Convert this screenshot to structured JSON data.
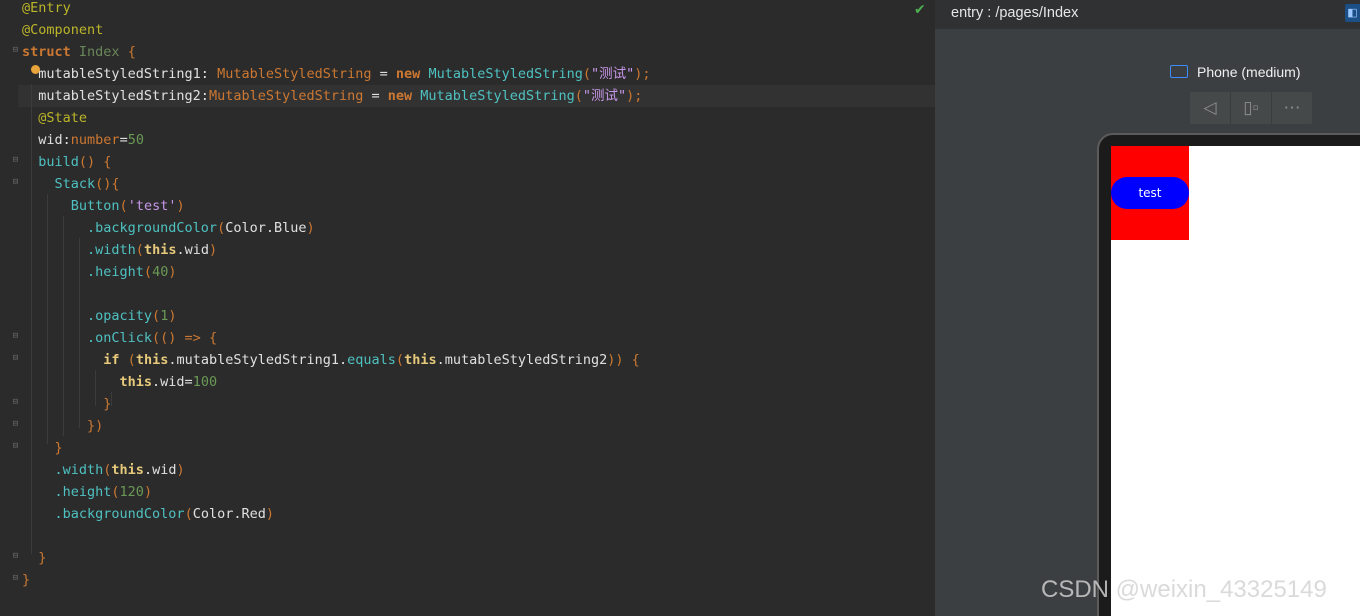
{
  "editor": {
    "lines": [
      [
        {
          "t": "@Entry",
          "c": "#bbb529"
        }
      ],
      [
        {
          "t": "@Component",
          "c": "#bbb529"
        }
      ],
      [
        {
          "t": "struct",
          "c": "#cc7832",
          "b": true
        },
        {
          "t": " "
        },
        {
          "t": "Index",
          "c": "#6a8759"
        },
        {
          "t": " {",
          "c": "#cc7832"
        }
      ],
      [
        {
          "t": "  mutableStyledString1: ",
          "c": "#e0e0e0"
        },
        {
          "t": "MutableStyledString",
          "c": "#cc7832"
        },
        {
          "t": " = ",
          "c": "#e0e0e0"
        },
        {
          "t": "new",
          "c": "#cc7832",
          "b": true
        },
        {
          "t": " "
        },
        {
          "t": "MutableStyledString",
          "c": "#4fc1c1"
        },
        {
          "t": "(",
          "c": "#cc7832"
        },
        {
          "t": "\"测试\"",
          "c": "#c896e8"
        },
        {
          "t": ");",
          "c": "#cc7832"
        }
      ],
      [
        {
          "t": "  mutableStyledString2:",
          "c": "#e0e0e0"
        },
        {
          "t": "MutableStyledString",
          "c": "#cc7832"
        },
        {
          "t": " = ",
          "c": "#e0e0e0"
        },
        {
          "t": "new",
          "c": "#cc7832",
          "b": true
        },
        {
          "t": " "
        },
        {
          "t": "MutableStyledString",
          "c": "#4fc1c1"
        },
        {
          "t": "(",
          "c": "#cc7832"
        },
        {
          "t": "\"测试\"",
          "c": "#c896e8"
        },
        {
          "t": ");",
          "c": "#cc7832"
        }
      ],
      [
        {
          "t": "  @State",
          "c": "#bbb529"
        }
      ],
      [
        {
          "t": "  wid:",
          "c": "#e0e0e0"
        },
        {
          "t": "number",
          "c": "#cc7832"
        },
        {
          "t": "=",
          "c": "#e0e0e0"
        },
        {
          "t": "50",
          "c": "#6a9955"
        }
      ],
      [
        {
          "t": "  build",
          "c": "#4fc1c1"
        },
        {
          "t": "() {",
          "c": "#cc7832"
        }
      ],
      [
        {
          "t": "    Stack",
          "c": "#4fc1c1"
        },
        {
          "t": "(){",
          "c": "#cc7832"
        }
      ],
      [
        {
          "t": "      Button",
          "c": "#4fc1c1"
        },
        {
          "t": "(",
          "c": "#cc7832"
        },
        {
          "t": "'test'",
          "c": "#c896e8"
        },
        {
          "t": ")",
          "c": "#cc7832"
        }
      ],
      [
        {
          "t": "        .backgroundColor",
          "c": "#4fc1c1"
        },
        {
          "t": "(",
          "c": "#cc7832"
        },
        {
          "t": "Color.Blue",
          "c": "#e0e0e0"
        },
        {
          "t": ")",
          "c": "#cc7832"
        }
      ],
      [
        {
          "t": "        .width",
          "c": "#4fc1c1"
        },
        {
          "t": "(",
          "c": "#cc7832"
        },
        {
          "t": "this",
          "c": "#e6c97a",
          "b": true
        },
        {
          "t": ".wid",
          "c": "#e0e0e0"
        },
        {
          "t": ")",
          "c": "#cc7832"
        }
      ],
      [
        {
          "t": "        .height",
          "c": "#4fc1c1"
        },
        {
          "t": "(",
          "c": "#cc7832"
        },
        {
          "t": "40",
          "c": "#6a9955"
        },
        {
          "t": ")",
          "c": "#cc7832"
        }
      ],
      [],
      [
        {
          "t": "        .opacity",
          "c": "#4fc1c1"
        },
        {
          "t": "(",
          "c": "#cc7832"
        },
        {
          "t": "1",
          "c": "#6a9955"
        },
        {
          "t": ")",
          "c": "#cc7832"
        }
      ],
      [
        {
          "t": "        .onClick",
          "c": "#4fc1c1"
        },
        {
          "t": "(() => {",
          "c": "#cc7832"
        }
      ],
      [
        {
          "t": "          if",
          "c": "#e6c97a",
          "b": true
        },
        {
          "t": " (",
          "c": "#cc7832"
        },
        {
          "t": "this",
          "c": "#e6c97a",
          "b": true
        },
        {
          "t": ".mutableStyledString1.",
          "c": "#e0e0e0"
        },
        {
          "t": "equals",
          "c": "#4fc1c1"
        },
        {
          "t": "(",
          "c": "#cc7832"
        },
        {
          "t": "this",
          "c": "#e6c97a",
          "b": true
        },
        {
          "t": ".mutableStyledString2",
          "c": "#e0e0e0"
        },
        {
          "t": ")) {",
          "c": "#cc7832"
        }
      ],
      [
        {
          "t": "            this",
          "c": "#e6c97a",
          "b": true
        },
        {
          "t": ".wid=",
          "c": "#e0e0e0"
        },
        {
          "t": "100",
          "c": "#6a9955"
        }
      ],
      [
        {
          "t": "          }",
          "c": "#cc7832"
        }
      ],
      [
        {
          "t": "        })",
          "c": "#cc7832"
        }
      ],
      [
        {
          "t": "    }",
          "c": "#cc7832"
        }
      ],
      [
        {
          "t": "    .width",
          "c": "#4fc1c1"
        },
        {
          "t": "(",
          "c": "#cc7832"
        },
        {
          "t": "this",
          "c": "#e6c97a",
          "b": true
        },
        {
          "t": ".wid",
          "c": "#e0e0e0"
        },
        {
          "t": ")",
          "c": "#cc7832"
        }
      ],
      [
        {
          "t": "    .height",
          "c": "#4fc1c1"
        },
        {
          "t": "(",
          "c": "#cc7832"
        },
        {
          "t": "120",
          "c": "#6a9955"
        },
        {
          "t": ")",
          "c": "#cc7832"
        }
      ],
      [
        {
          "t": "    .backgroundColor",
          "c": "#4fc1c1"
        },
        {
          "t": "(",
          "c": "#cc7832"
        },
        {
          "t": "Color.Red",
          "c": "#e0e0e0"
        },
        {
          "t": ")",
          "c": "#cc7832"
        }
      ],
      [],
      [
        {
          "t": "  }",
          "c": "#cc7832"
        }
      ],
      [
        {
          "t": "}",
          "c": "#cc7832"
        }
      ]
    ]
  },
  "preview": {
    "path": "entry : /pages/Index",
    "device_name": "Phone (medium)",
    "toolbar_icons": [
      "back-triangle-icon",
      "device-rotate-icon",
      "more-dots-icon"
    ],
    "app_button_label": "test",
    "stack_color": "#ff0000",
    "button_color": "#0000ff"
  },
  "watermark": "CSDN @weixin_43325149"
}
